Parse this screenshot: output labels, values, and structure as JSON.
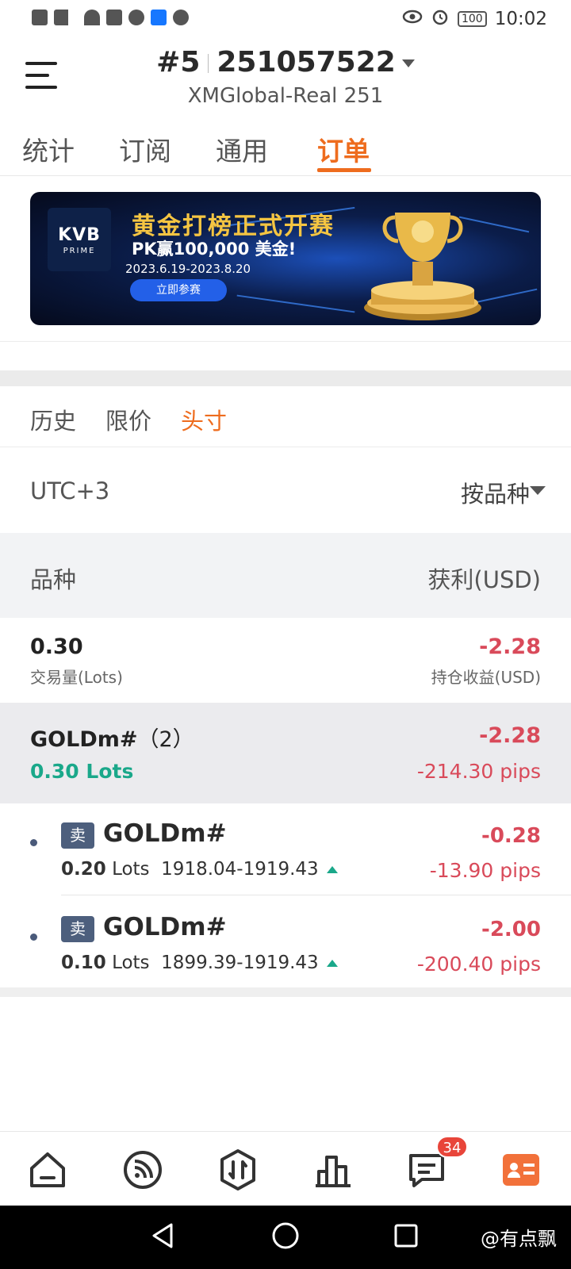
{
  "status_bar": {
    "time": "10:02",
    "battery": "100"
  },
  "header": {
    "account_number": "#5",
    "account_id": "251057522",
    "server": "XMGlobal-Real 251"
  },
  "tabs": [
    {
      "label": "统计",
      "active": false
    },
    {
      "label": "订阅",
      "active": false
    },
    {
      "label": "通用",
      "active": false
    },
    {
      "label": "订单",
      "active": true
    }
  ],
  "banner": {
    "brand": "KVB",
    "brand_sub": "PRIME",
    "title": "黄金打榜正式开赛",
    "subtitle": "PK赢100,000 美金!",
    "dates": "2023.6.19-2023.8.20",
    "cta": "立即参赛"
  },
  "order_tabs": [
    {
      "label": "历史",
      "active": false
    },
    {
      "label": "限价",
      "active": false
    },
    {
      "label": "头寸",
      "active": true
    }
  ],
  "filters": {
    "timezone": "UTC+3",
    "sort_by": "按品种"
  },
  "columns": {
    "symbol": "品种",
    "profit": "获利(USD)"
  },
  "summary": {
    "volume": "0.30",
    "volume_label": "交易量(Lots)",
    "profit": "-2.28",
    "profit_label": "持仓收益(USD)"
  },
  "group": {
    "symbol": "GOLDm#",
    "count": "（2）",
    "lots": "0.30 Lots",
    "profit": "-2.28",
    "pips": "-214.30 pips"
  },
  "positions": [
    {
      "side": "卖",
      "symbol": "GOLDm#",
      "lots": "0.20",
      "lots_unit": "Lots",
      "prices": "1918.04-1919.43",
      "profit": "-0.28",
      "pips": "-13.90 pips"
    },
    {
      "side": "卖",
      "symbol": "GOLDm#",
      "lots": "0.10",
      "lots_unit": "Lots",
      "prices": "1899.39-1919.43",
      "profit": "-2.00",
      "pips": "-200.40 pips"
    }
  ],
  "bottom_nav": {
    "items": [
      "home-icon",
      "feed-icon",
      "trade-icon",
      "chart-icon",
      "messages-icon",
      "account-icon"
    ],
    "messages_badge": "34",
    "active": "account-icon"
  },
  "watermark": "@有点飘",
  "colors": {
    "accent": "#ee6c1e",
    "loss": "#d94a5a",
    "gain": "#1aa88a",
    "badge": "#4d5f7d"
  }
}
